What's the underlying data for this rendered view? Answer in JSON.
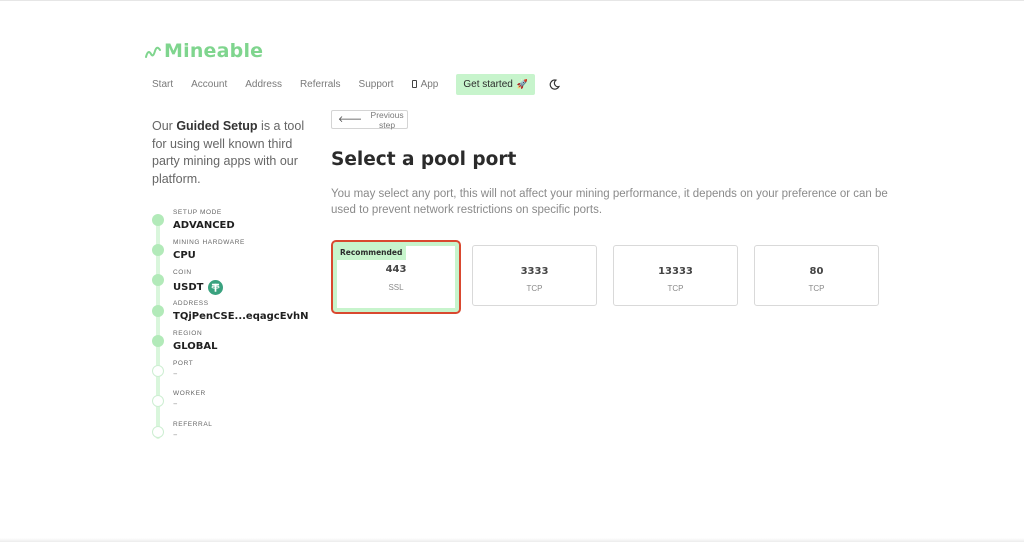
{
  "brand": {
    "name": "Mineable",
    "color": "#7fd58e"
  },
  "nav": {
    "links": [
      "Start",
      "Account",
      "Address",
      "Referrals",
      "Support"
    ],
    "app_label": "App",
    "cta_label": "Get started",
    "cta_emoji": "🚀",
    "cta_color": "#c7f4cc"
  },
  "intro": {
    "prefix": "Our ",
    "bold": "Guided Setup",
    "suffix": " is a tool for using well known third party mining apps with our platform."
  },
  "steps": [
    {
      "label": "SETUP MODE",
      "value": "ADVANCED",
      "done": true
    },
    {
      "label": "MINING HARDWARE",
      "value": "CPU",
      "done": true
    },
    {
      "label": "COIN",
      "value": "USDT",
      "done": true,
      "icon": "tether-icon"
    },
    {
      "label": "ADDRESS",
      "value": "TQjPenCSE...eqagcEvhN",
      "done": true
    },
    {
      "label": "REGION",
      "value": "GLOBAL",
      "done": true
    },
    {
      "label": "PORT",
      "value": "–",
      "done": false
    },
    {
      "label": "WORKER",
      "value": "–",
      "done": false
    },
    {
      "label": "REFERRAL",
      "value": "–",
      "done": false
    }
  ],
  "main": {
    "prev_label": "Previous step",
    "title": "Select a pool port",
    "description": "You may select any port, this will not affect your mining performance, it depends on your preference or can be used to prevent network restrictions on specific ports."
  },
  "ports": [
    {
      "port": "443",
      "protocol": "SSL",
      "recommended": true,
      "badge": "Recommended"
    },
    {
      "port": "3333",
      "protocol": "TCP",
      "recommended": false
    },
    {
      "port": "13333",
      "protocol": "TCP",
      "recommended": false
    },
    {
      "port": "80",
      "protocol": "TCP",
      "recommended": false
    }
  ],
  "colors": {
    "highlight_outline": "#d9482f",
    "step_done": "#b2eab9"
  }
}
